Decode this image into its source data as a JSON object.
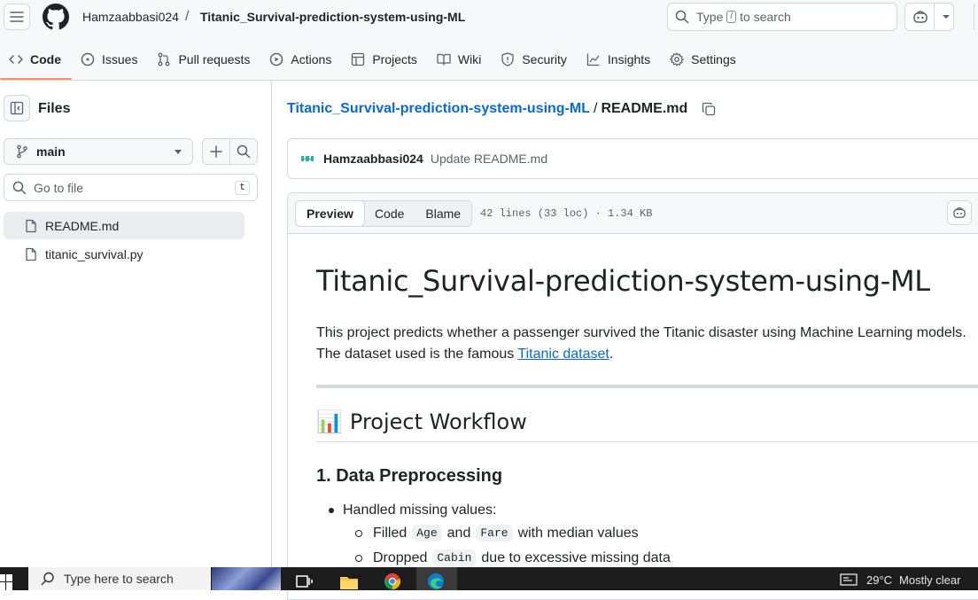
{
  "header": {
    "owner": "Hamzaabbasi024",
    "separator": "/",
    "repo": "Titanic_Survival-prediction-system-using-ML",
    "search_prefix": "Type",
    "search_key": "/",
    "search_suffix": "to search"
  },
  "tabs": [
    {
      "label": "Code",
      "icon": "code-icon",
      "selected": true
    },
    {
      "label": "Issues",
      "icon": "issue-icon"
    },
    {
      "label": "Pull requests",
      "icon": "pull-request-icon"
    },
    {
      "label": "Actions",
      "icon": "play-icon"
    },
    {
      "label": "Projects",
      "icon": "table-icon"
    },
    {
      "label": "Wiki",
      "icon": "book-icon"
    },
    {
      "label": "Security",
      "icon": "shield-icon"
    },
    {
      "label": "Insights",
      "icon": "graph-icon"
    },
    {
      "label": "Settings",
      "icon": "gear-icon"
    }
  ],
  "sidebar": {
    "title": "Files",
    "branch": "main",
    "goto_placeholder": "Go to file",
    "goto_key": "t",
    "files": [
      {
        "name": "README.md",
        "selected": true
      },
      {
        "name": "titanic_survival.py",
        "selected": false
      }
    ]
  },
  "main": {
    "path_repo": "Titanic_Survival-prediction-system-using-ML",
    "path_sep": "/",
    "path_file": "README.md",
    "commit_author": "Hamzaabbasi024",
    "commit_message": "Update README.md",
    "view_tabs": [
      "Preview",
      "Code",
      "Blame"
    ],
    "file_meta": "42 lines (33 loc) · 1.34 KB"
  },
  "readme": {
    "h1": "Titanic_Survival-prediction-system-using-ML",
    "p1_line1": "This project predicts whether a passenger survived the Titanic disaster using Machine Learning models.",
    "p1_line2_prefix": "The dataset used is the famous",
    "p1_link": "Titanic dataset",
    "p1_line2_suffix": ".",
    "h2_emoji": "📊",
    "h2": "Project Workflow",
    "h3": "1. Data Preprocessing",
    "li1": "Handled missing values:",
    "li2a_pre": "Filled",
    "li2a_code1": "Age",
    "li2a_mid": "and",
    "li2a_code2": "Fare",
    "li2a_post": "with median values",
    "li2b_pre": "Dropped",
    "li2b_code": "Cabin",
    "li2b_post": "due to excessive missing data"
  },
  "taskbar": {
    "search_placeholder": "Type here to search",
    "temperature": "29°C",
    "weather": "Mostly clear"
  },
  "colors": {
    "accent_link": "#0969da",
    "tab_underline": "#fd8c73",
    "border": "#d1d9e0"
  }
}
